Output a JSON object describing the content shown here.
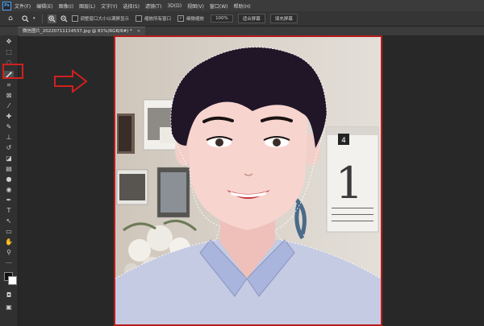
{
  "app": {
    "logo": "Ps"
  },
  "menu": [
    "文件(F)",
    "编辑(E)",
    "图像(I)",
    "图层(L)",
    "文字(Y)",
    "选择(S)",
    "滤镜(T)",
    "3D(D)",
    "视图(V)",
    "窗口(W)",
    "帮助(H)"
  ],
  "options": {
    "resize_windows_label": "调整窗口大小以满屏显示",
    "zoom_all_label": "缩放所有窗口",
    "scrubby_zoom_label": "细微缩放",
    "zoom_value": "100%",
    "fit_screen_label": "适合屏幕",
    "fill_screen_label": "填充屏幕"
  },
  "document_tab": {
    "title": "微信图片_20220711114537.jpg @ 81%(RGB/8#) *",
    "close": "×"
  },
  "tools": [
    "move-icon",
    "marquee-icon",
    "lasso-icon",
    "magic-wand-icon",
    "crop-icon",
    "frame-icon",
    "eyedropper-icon",
    "healing-brush-icon",
    "brush-icon",
    "clone-stamp-icon",
    "history-brush-icon",
    "eraser-icon",
    "gradient-icon",
    "blur-icon",
    "dodge-icon",
    "pen-icon",
    "type-icon",
    "path-selection-icon",
    "shape-icon",
    "hand-icon",
    "zoom-icon",
    "more-tools-icon"
  ],
  "calendar": {
    "month": "4",
    "day": "1"
  },
  "colors": {
    "highlight": "#d02020",
    "canvas_border": "#b81c1c",
    "shirt": "#c5cbe3",
    "hair": "#201628"
  }
}
